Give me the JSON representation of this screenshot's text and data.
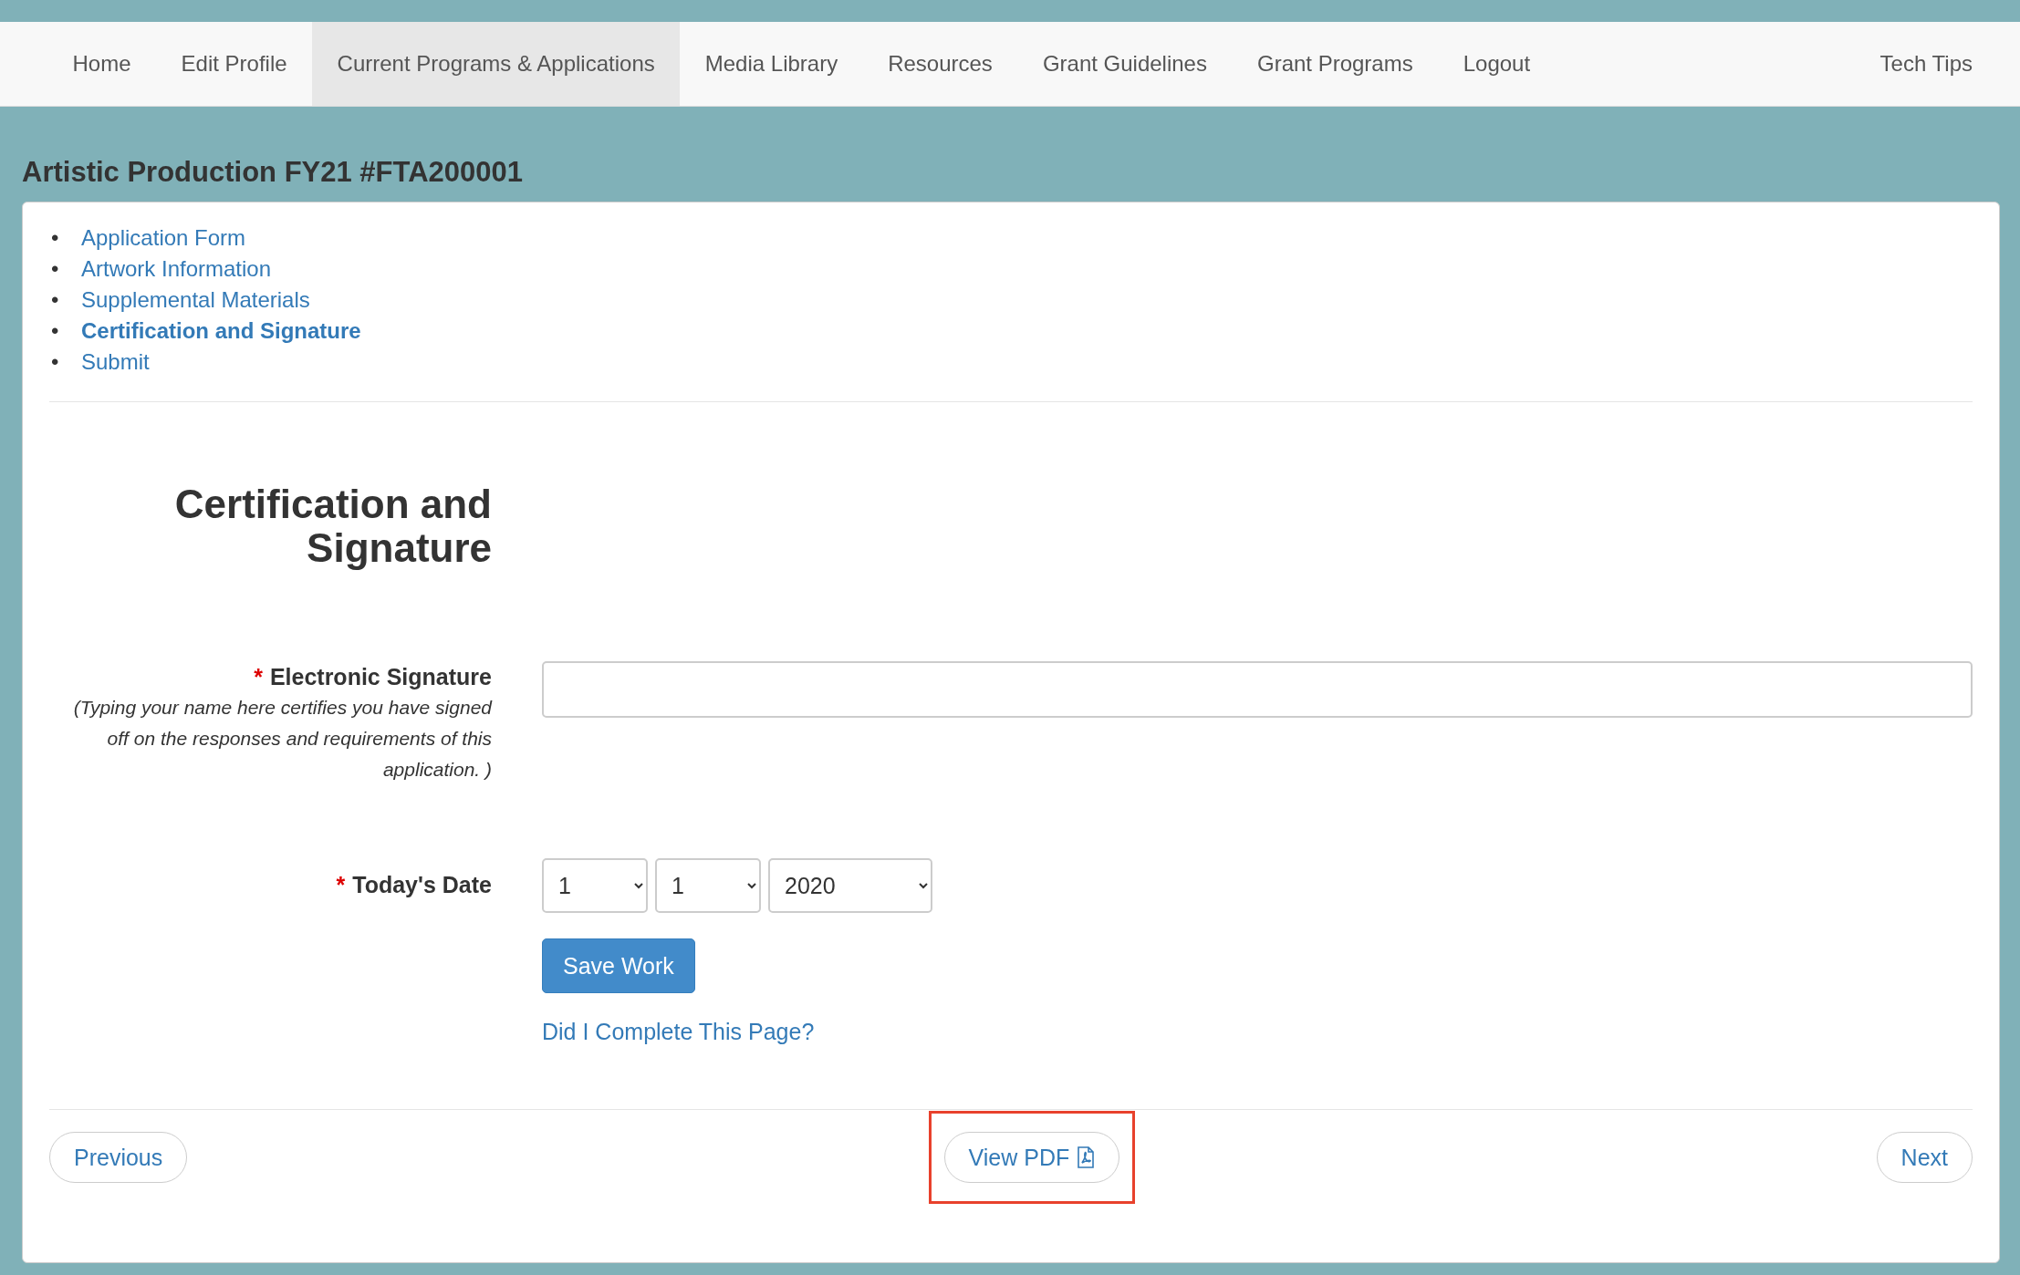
{
  "nav": {
    "items": [
      {
        "label": "Home",
        "selected": false
      },
      {
        "label": "Edit Profile",
        "selected": false
      },
      {
        "label": "Current Programs & Applications",
        "selected": true
      },
      {
        "label": "Media Library",
        "selected": false
      },
      {
        "label": "Resources",
        "selected": false
      },
      {
        "label": "Grant Guidelines",
        "selected": false
      },
      {
        "label": "Grant Programs",
        "selected": false
      },
      {
        "label": "Logout",
        "selected": false
      }
    ],
    "right_item": "Tech Tips"
  },
  "page_title": "Artistic Production FY21 #FTA200001",
  "steps": [
    {
      "bullet": "•",
      "label": "Application Form",
      "selected": false
    },
    {
      "bullet": "•",
      "label": "Artwork Information",
      "selected": false
    },
    {
      "bullet": "•",
      "label": "Supplemental Materials",
      "selected": false
    },
    {
      "bullet": "•",
      "label": "Certification and Signature",
      "selected": true
    },
    {
      "bullet": "•",
      "label": "Submit",
      "selected": false
    }
  ],
  "section_title": "Certification and Signature",
  "signature": {
    "required_mark": "*",
    "label": "Electronic Signature",
    "help": "(Typing your name here certifies you have signed off on the responses and requirements of this application. )"
  },
  "date": {
    "required_mark": "*",
    "label": "Today's Date",
    "selects": [
      "1",
      "1",
      "2020"
    ]
  },
  "save_button": "Save Work",
  "check_link": "Did I Complete This Page?",
  "footer": {
    "previous": "Previous",
    "view_pdf": "View PDF",
    "view_pdf_highlighted": true,
    "next": "Next"
  }
}
